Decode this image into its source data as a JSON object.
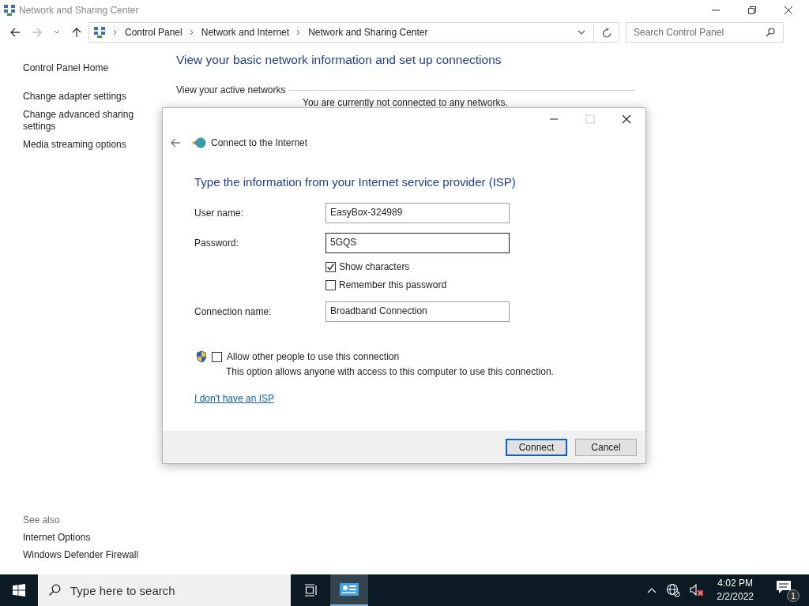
{
  "window": {
    "title": "Network and Sharing Center"
  },
  "nav": {
    "breadcrumb": [
      "Control Panel",
      "Network and Internet",
      "Network and Sharing Center"
    ],
    "search": {
      "placeholder": "Search Control Panel"
    }
  },
  "sidebar": {
    "links": [
      "Control Panel Home",
      "Change adapter settings",
      "Change advanced sharing settings",
      "Media streaming options"
    ],
    "see_also_heading": "See also",
    "see_also": [
      "Internet Options",
      "Windows Defender Firewall"
    ]
  },
  "main": {
    "heading": "View your basic network information and set up connections",
    "section": "View your active networks",
    "status": "You are currently not connected to any networks."
  },
  "dialog": {
    "title": "Connect to the Internet",
    "heading": "Type the information from your Internet service provider (ISP)",
    "rows": [
      {
        "kind": "field",
        "label": "User name:",
        "value": "EasyBox-324989",
        "focused": false
      },
      {
        "kind": "field",
        "label": "Password:",
        "value": "5GQS",
        "focused": true
      },
      {
        "kind": "checkbox",
        "label": "Show characters",
        "checked": true
      },
      {
        "kind": "checkbox",
        "label": "Remember this password",
        "checked": false
      },
      {
        "kind": "field",
        "label": "Connection name:",
        "value": "Broadband Connection",
        "focused": false
      }
    ],
    "allow": {
      "label": "Allow other people to use this connection",
      "checked": false,
      "note": "This option allows anyone with access to this computer to use this connection."
    },
    "link": "I don't have an ISP",
    "buttons": [
      {
        "label": "Connect",
        "default": true
      },
      {
        "label": "Cancel",
        "default": false
      }
    ]
  },
  "taskbar": {
    "search_placeholder": "Type here to search",
    "time": "4:02 PM",
    "date": "2/2/2022",
    "notification_count": "1"
  }
}
